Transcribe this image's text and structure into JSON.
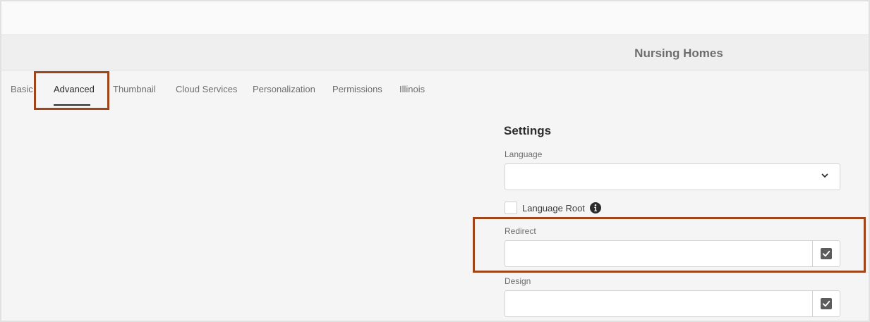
{
  "page": {
    "title": "Nursing Homes"
  },
  "tabs": [
    {
      "label": "Basic",
      "active": false
    },
    {
      "label": "Advanced",
      "active": true
    },
    {
      "label": "Thumbnail",
      "active": false
    },
    {
      "label": "Cloud Services",
      "active": false
    },
    {
      "label": "Personalization",
      "active": false
    },
    {
      "label": "Permissions",
      "active": false
    },
    {
      "label": "Illinois",
      "active": false
    }
  ],
  "settings": {
    "title": "Settings",
    "language": {
      "label": "Language",
      "value": "",
      "icon": "chevron-down-icon"
    },
    "language_root": {
      "label": "Language Root",
      "checked": false,
      "info_icon": "info-icon"
    },
    "redirect": {
      "label": "Redirect",
      "value": "",
      "icon": "check-icon"
    },
    "design": {
      "label": "Design",
      "value": "",
      "icon": "check-icon"
    }
  },
  "colors": {
    "highlight": "#a0441a",
    "active_tab": "#2c2c2c",
    "background": "#f5f5f5"
  }
}
